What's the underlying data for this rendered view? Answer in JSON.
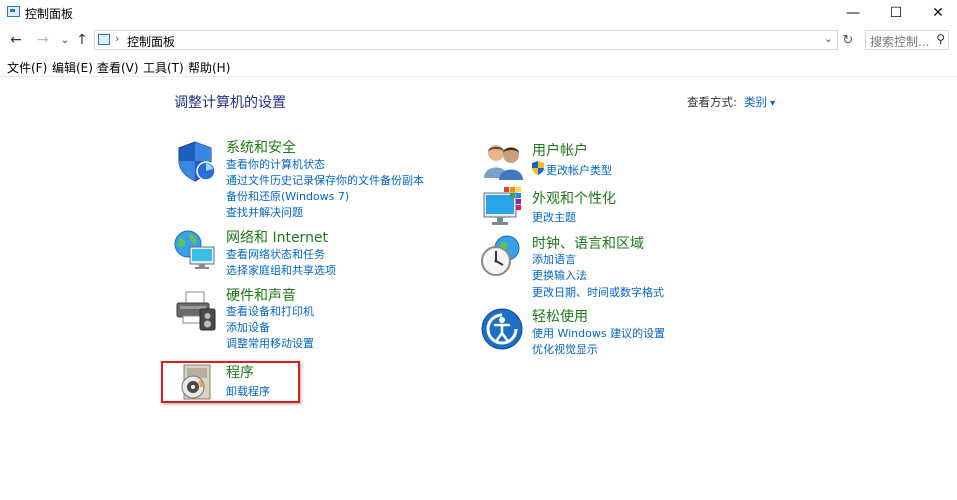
{
  "window": {
    "title": "控制面板",
    "min_glyph": "—",
    "max_glyph": "☐",
    "close_glyph": "✕"
  },
  "nav": {
    "breadcrumb": "控制面板",
    "search_placeholder": "搜索控制..."
  },
  "menu": [
    "文件(F)",
    "编辑(E)",
    "查看(V)",
    "工具(T)",
    "帮助(H)"
  ],
  "main": {
    "heading": "调整计算机的设置",
    "view_by_label": "查看方式:",
    "view_by_value": "类别"
  },
  "categories": [
    {
      "title": "系统和安全",
      "icon": "shield-icon",
      "links": [
        "查看你的计算机状态",
        "通过文件历史记录保存你的文件备份副本",
        "备份和还原(Windows 7)",
        "查找并解决问题"
      ]
    },
    {
      "title": "网络和 Internet",
      "icon": "network-globe-icon",
      "links": [
        "查看网络状态和任务",
        "选择家庭组和共享选项"
      ]
    },
    {
      "title": "硬件和声音",
      "icon": "printer-icon",
      "links": [
        "查看设备和打印机",
        "添加设备",
        "调整常用移动设置"
      ]
    },
    {
      "title": "程序",
      "icon": "programs-disc-icon",
      "links": [
        "卸载程序"
      ]
    },
    {
      "title": "用户帐户",
      "icon": "users-icon",
      "links": [
        "更改帐户类型"
      ]
    },
    {
      "title": "外观和个性化",
      "icon": "monitor-palette-icon",
      "links": [
        "更改主题"
      ]
    },
    {
      "title": "时钟、语言和区域",
      "icon": "clock-globe-icon",
      "links": [
        "添加语言",
        "更换输入法",
        "更改日期、时间或数字格式"
      ]
    },
    {
      "title": "轻松使用",
      "icon": "ease-of-access-icon",
      "links": [
        "使用 Windows 建议的设置",
        "优化视觉显示"
      ]
    }
  ],
  "colors": {
    "title_green": "#1b7a16",
    "link_blue": "#0066cc",
    "heading_blue": "#1e3287",
    "highlight_red": "#d42020"
  }
}
